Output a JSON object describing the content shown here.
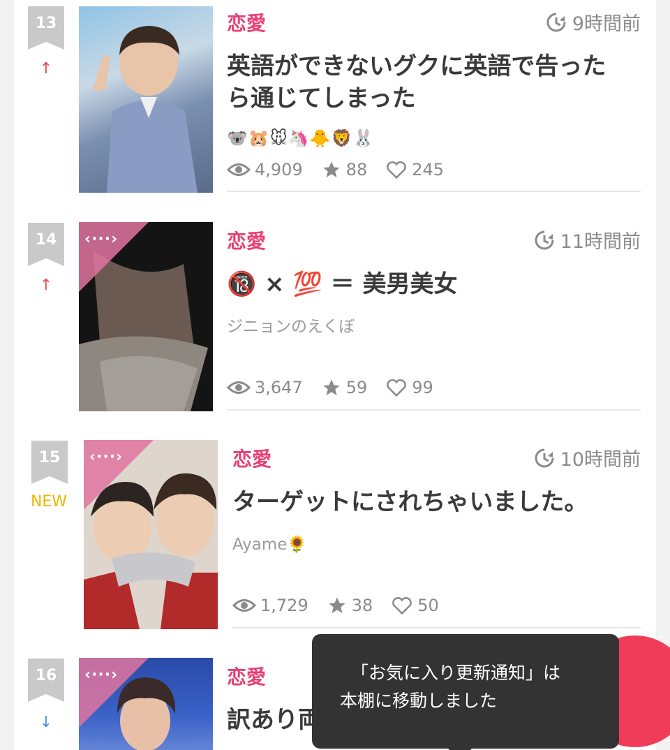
{
  "items": [
    {
      "rank": "13",
      "trend": "↑",
      "category": "恋愛",
      "time": "9時間前",
      "title_lines": [
        "英語ができないグクに英語で告った",
        "ら通じてしまった"
      ],
      "author": "🐨🐹🐭🦄🐥🦁🐰",
      "views": "4,909",
      "stars": "88",
      "likes": "245"
    },
    {
      "rank": "14",
      "trend": "↑",
      "category": "恋愛",
      "time": "11時間前",
      "title_lines": [
        "🔞 × 💯 ＝ 美男美女"
      ],
      "author": "ジニョンのえくぼ",
      "views": "3,647",
      "stars": "59",
      "likes": "99",
      "corner_icon": "‹···›"
    },
    {
      "rank": "15",
      "trend": "NEW",
      "category": "恋愛",
      "time": "10時間前",
      "title_lines": [
        "ターゲットにされちゃいました。"
      ],
      "author": "Ayame🌻",
      "views": "1,729",
      "stars": "38",
      "likes": "50",
      "corner_icon": "‹···›"
    },
    {
      "rank": "16",
      "trend": "↓",
      "category": "恋愛",
      "title_lines": [
        "訳あり両"
      ],
      "corner_icon": "‹···›"
    }
  ],
  "toast": {
    "line1": "「お気に入り更新通知」は",
    "line2": "本棚に移動しました"
  },
  "colors": {
    "category": "#e84074",
    "up": "#e94a4a",
    "down": "#4a8fe9",
    "new": "#f2b400",
    "badge": "#c9c9c9",
    "fab": "#f03c58"
  }
}
